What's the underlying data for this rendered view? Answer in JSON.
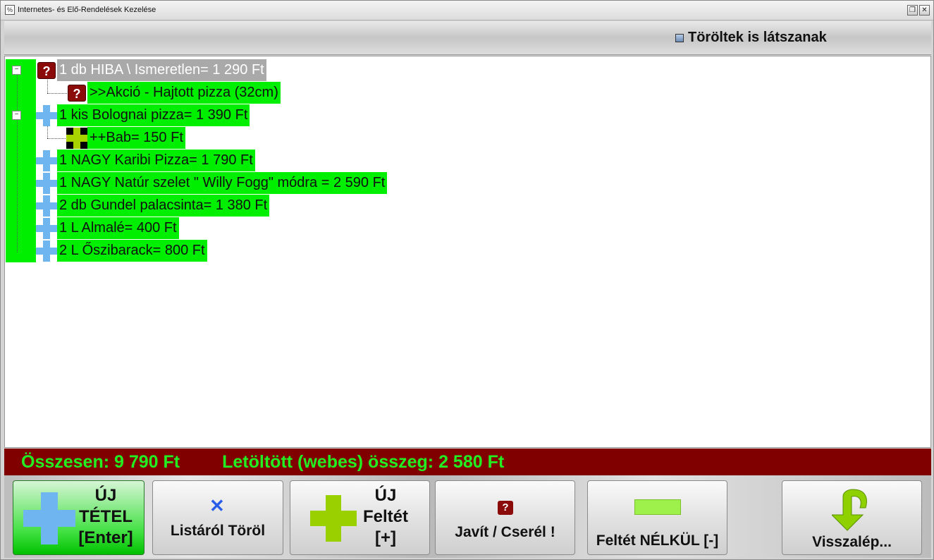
{
  "window": {
    "title": "Internetes- és Elő-Rendelések Kezelése",
    "icon_char": "%"
  },
  "top": {
    "show_deleted_label": "Töröltek is látszanak",
    "show_deleted_checked": false
  },
  "tree": {
    "items": [
      {
        "label": "1 db HIBA \\ Ismeretlen= 1 290 Ft",
        "icon": "question-icon",
        "level": 0,
        "expanded": true,
        "selected": true
      },
      {
        "label": ">>Akció - Hajtott pizza (32cm)",
        "icon": "question-icon",
        "level": 1,
        "selected": false
      },
      {
        "label": "1 kis Bolognai pizza= 1 390 Ft",
        "icon": "blue-plus-icon",
        "level": 0,
        "expanded": true,
        "selected": false
      },
      {
        "label": "++Bab=  150 Ft",
        "icon": "green-plus-icon",
        "level": 1,
        "selected": false
      },
      {
        "label": "1 NAGY Karibi Pizza= 1 790 Ft",
        "icon": "blue-plus-icon",
        "level": 0,
        "selected": false
      },
      {
        "label": "1 NAGY Natúr szelet \" Willy Fogg\" módra = 2 590 Ft",
        "icon": "blue-plus-icon",
        "level": 0,
        "selected": false
      },
      {
        "label": "2 db Gundel palacsinta= 1 380 Ft",
        "icon": "blue-plus-icon",
        "level": 0,
        "selected": false
      },
      {
        "label": "1 L Almalé=  400 Ft",
        "icon": "blue-plus-icon",
        "level": 0,
        "selected": false
      },
      {
        "label": "2 L Őszibarack=  800 Ft",
        "icon": "blue-plus-icon",
        "level": 0,
        "selected": false
      }
    ],
    "expander_symbol": "−"
  },
  "totals": {
    "total_text": "Összesen:  9 790 Ft",
    "downloaded_text": "Letöltött (webes) összeg:  2 580 Ft",
    "text_color": "#22ee22",
    "bar_color": "#800000"
  },
  "buttons": {
    "new_item": {
      "line1": "ÚJ",
      "line2": "TÉTEL",
      "line3": "[Enter]"
    },
    "delete_from_list": {
      "label": "Listáról Töröl",
      "icon": "x-icon"
    },
    "new_topping": {
      "line1": "ÚJ",
      "line2": "Feltét",
      "line3": "[+]"
    },
    "fix_replace": {
      "label": "Javít / Cserél !",
      "icon": "question-icon"
    },
    "without_topping": {
      "label": "Feltét NÉLKÜL [-]",
      "icon": "minus-icon"
    },
    "back": {
      "label": "Visszalép...",
      "icon": "arrow-down-icon"
    }
  },
  "colors": {
    "row_highlight": "#00ef00",
    "selected_row": "#a9a9a9",
    "blue_plus": "#6fb6f0",
    "green_plus": "#a8d300"
  }
}
